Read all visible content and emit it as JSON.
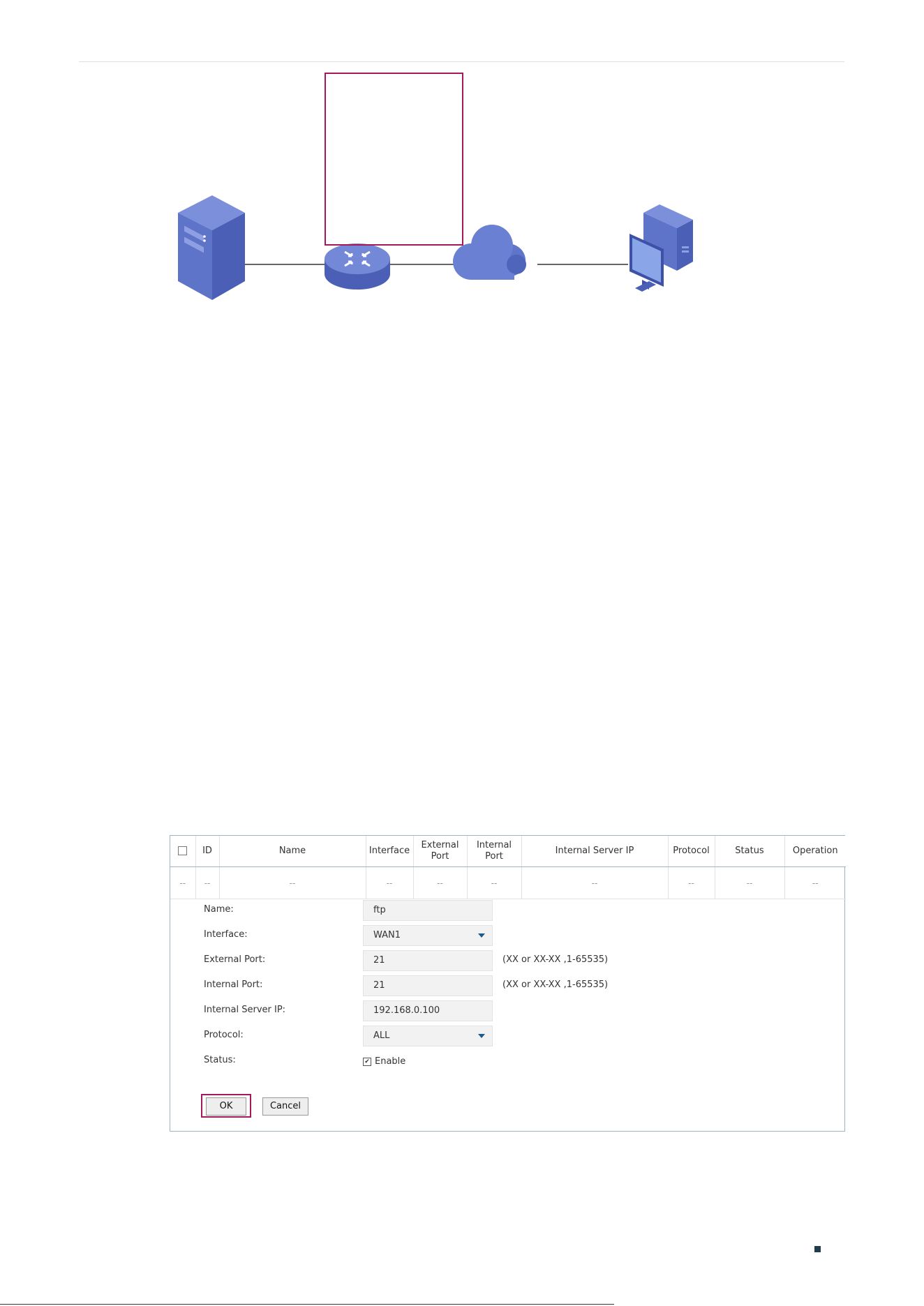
{
  "table": {
    "headers": [
      "",
      "ID",
      "Name",
      "Interface",
      "External Port",
      "Internal Port",
      "Internal Server IP",
      "Protocol",
      "Status",
      "Operation"
    ],
    "empty_row": [
      "--",
      "--",
      "--",
      "--",
      "--",
      "--",
      "--",
      "--",
      "--",
      "--"
    ]
  },
  "form": {
    "name": {
      "label": "Name:",
      "value": "ftp"
    },
    "interface": {
      "label": "Interface:",
      "value": "WAN1"
    },
    "external_port": {
      "label": "External Port:",
      "value": "21",
      "hint": "(XX or XX-XX ,1-65535)"
    },
    "internal_port": {
      "label": "Internal Port:",
      "value": "21",
      "hint": "(XX or XX-XX ,1-65535)"
    },
    "internal_server_ip": {
      "label": "Internal Server IP:",
      "value": "192.168.0.100"
    },
    "protocol": {
      "label": "Protocol:",
      "value": "ALL"
    },
    "status": {
      "label": "Status:",
      "option": "Enable",
      "checked": true
    }
  },
  "buttons": {
    "ok": "OK",
    "cancel": "Cancel"
  },
  "colors": {
    "highlight": "#a3195b",
    "device": "#5f75c9",
    "accent": "#1e5b8a"
  },
  "topology_icons": [
    "server-icon",
    "router-icon",
    "cloud-icon",
    "computer-icon"
  ]
}
